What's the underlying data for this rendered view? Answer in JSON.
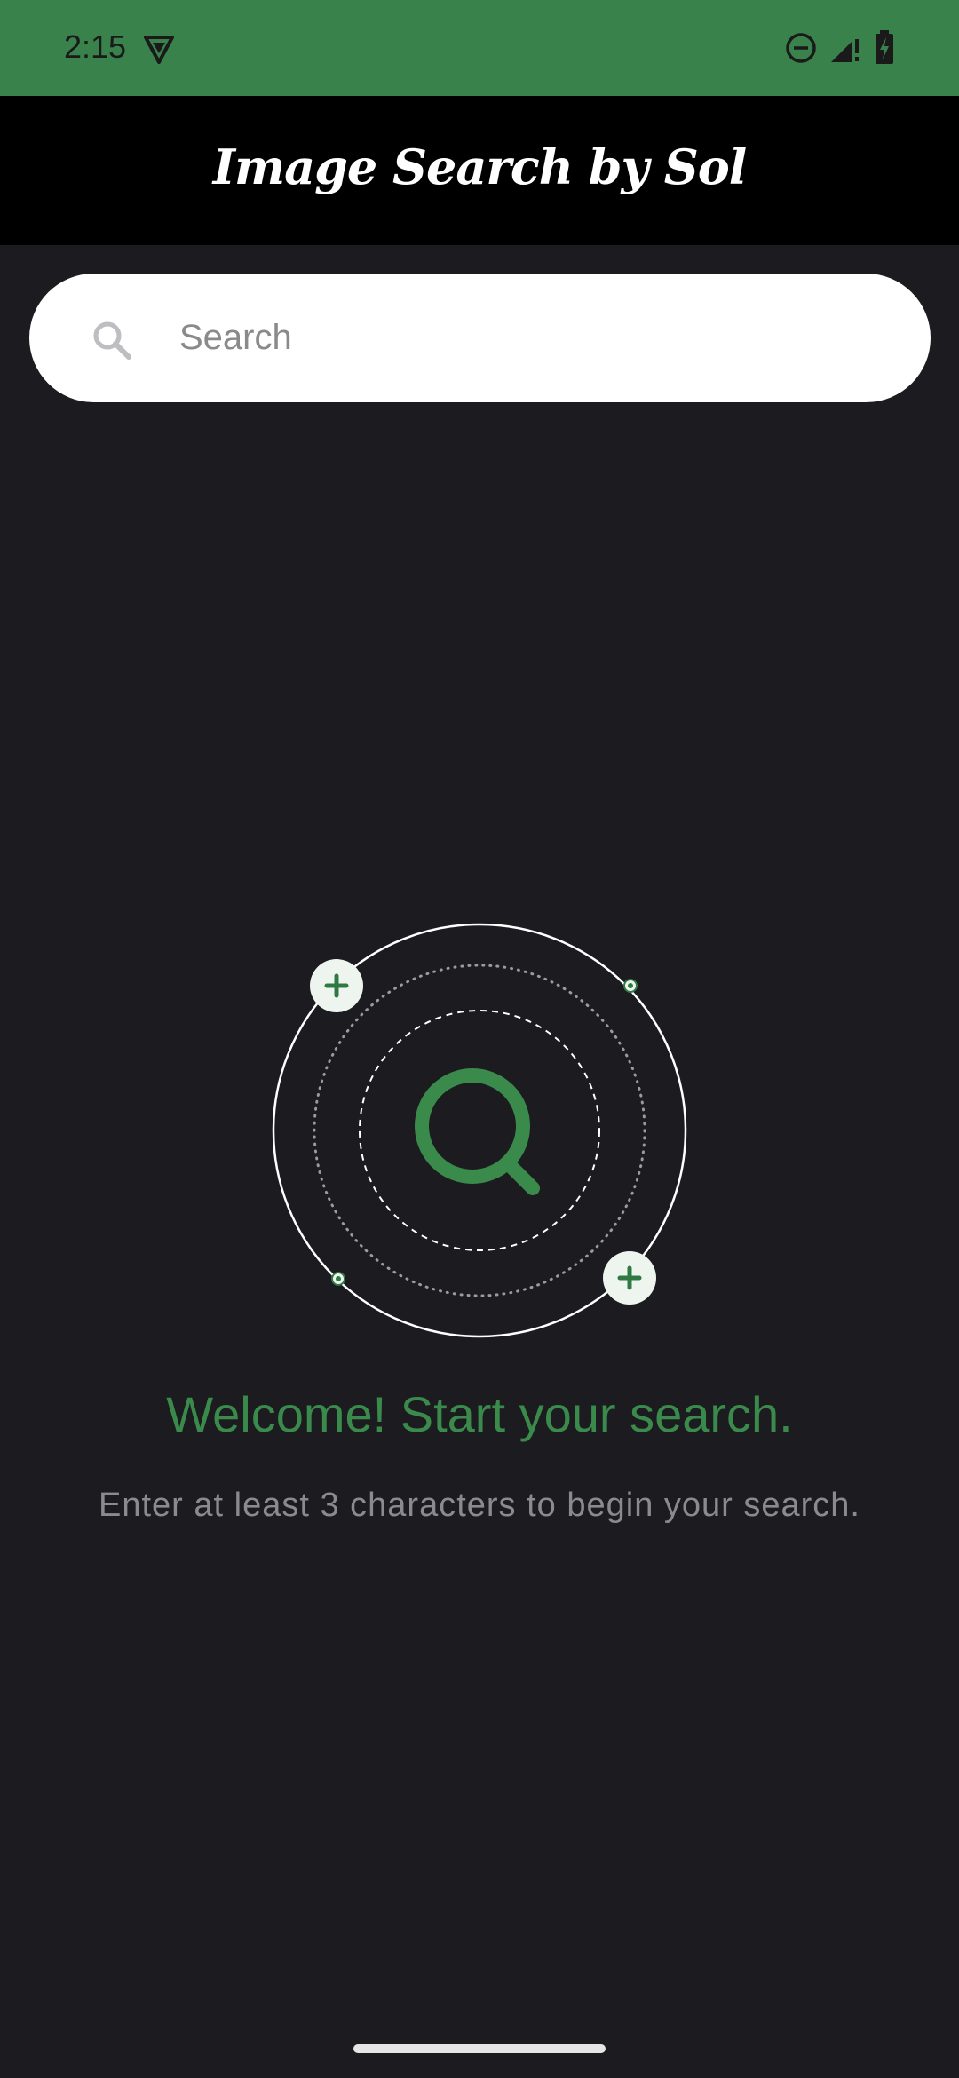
{
  "status_bar": {
    "time": "2:15",
    "background_color": "#3a824c",
    "icons": [
      "vpn-shield-icon",
      "do-not-disturb-icon",
      "signal-icon",
      "battery-charging-icon"
    ]
  },
  "app_bar": {
    "title": "Image Search by Sol",
    "background_color": "#000000"
  },
  "search": {
    "placeholder": "Search",
    "value": ""
  },
  "empty_state": {
    "title": "Welcome! Start your search.",
    "subtitle": "Enter at least 3 characters to begin your search.",
    "accent_color": "#3a8a4c",
    "illustration_icon": "magnifier-orbit-icon"
  },
  "colors": {
    "background": "#1c1b20",
    "accent": "#3a8a4c"
  }
}
